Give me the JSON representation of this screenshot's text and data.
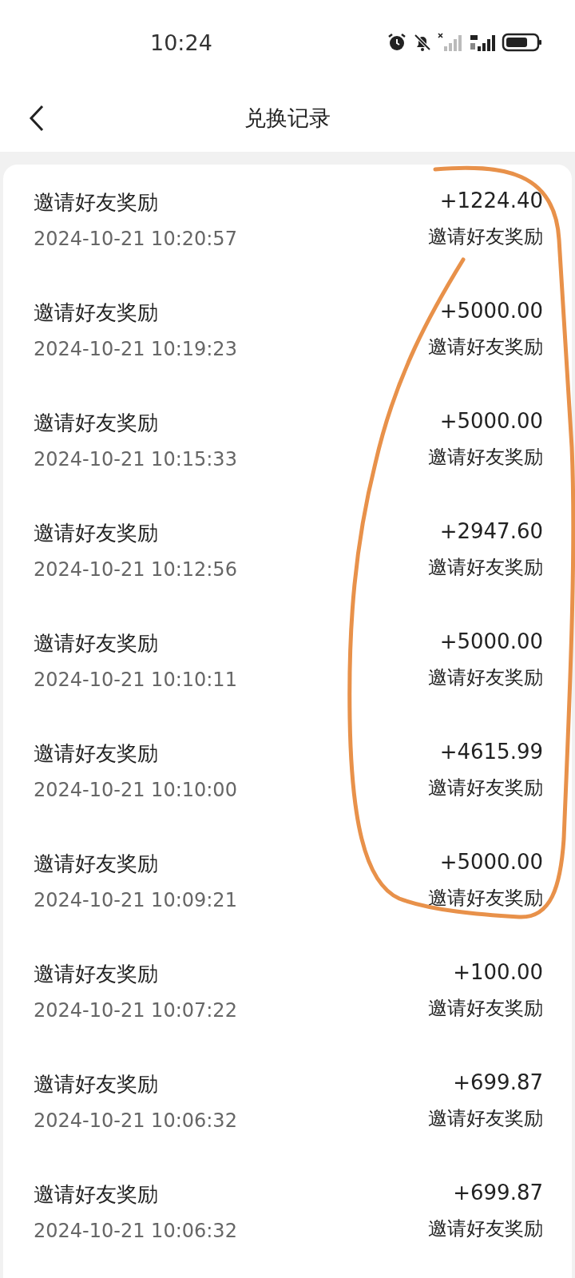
{
  "status_bar": {
    "time": "10:24"
  },
  "header": {
    "title": "兑换记录"
  },
  "records": [
    {
      "title": "邀请好友奖励",
      "date": "2024-10-21 10:20:57",
      "amount": "+1224.40",
      "category": "邀请好友奖励"
    },
    {
      "title": "邀请好友奖励",
      "date": "2024-10-21 10:19:23",
      "amount": "+5000.00",
      "category": "邀请好友奖励"
    },
    {
      "title": "邀请好友奖励",
      "date": "2024-10-21 10:15:33",
      "amount": "+5000.00",
      "category": "邀请好友奖励"
    },
    {
      "title": "邀请好友奖励",
      "date": "2024-10-21 10:12:56",
      "amount": "+2947.60",
      "category": "邀请好友奖励"
    },
    {
      "title": "邀请好友奖励",
      "date": "2024-10-21 10:10:11",
      "amount": "+5000.00",
      "category": "邀请好友奖励"
    },
    {
      "title": "邀请好友奖励",
      "date": "2024-10-21 10:10:00",
      "amount": "+4615.99",
      "category": "邀请好友奖励"
    },
    {
      "title": "邀请好友奖励",
      "date": "2024-10-21 10:09:21",
      "amount": "+5000.00",
      "category": "邀请好友奖励"
    },
    {
      "title": "邀请好友奖励",
      "date": "2024-10-21 10:07:22",
      "amount": "+100.00",
      "category": "邀请好友奖励"
    },
    {
      "title": "邀请好友奖励",
      "date": "2024-10-21 10:06:32",
      "amount": "+699.87",
      "category": "邀请好友奖励"
    },
    {
      "title": "邀请好友奖励",
      "date": "2024-10-21 10:06:32",
      "amount": "+699.87",
      "category": "邀请好友奖励"
    }
  ]
}
